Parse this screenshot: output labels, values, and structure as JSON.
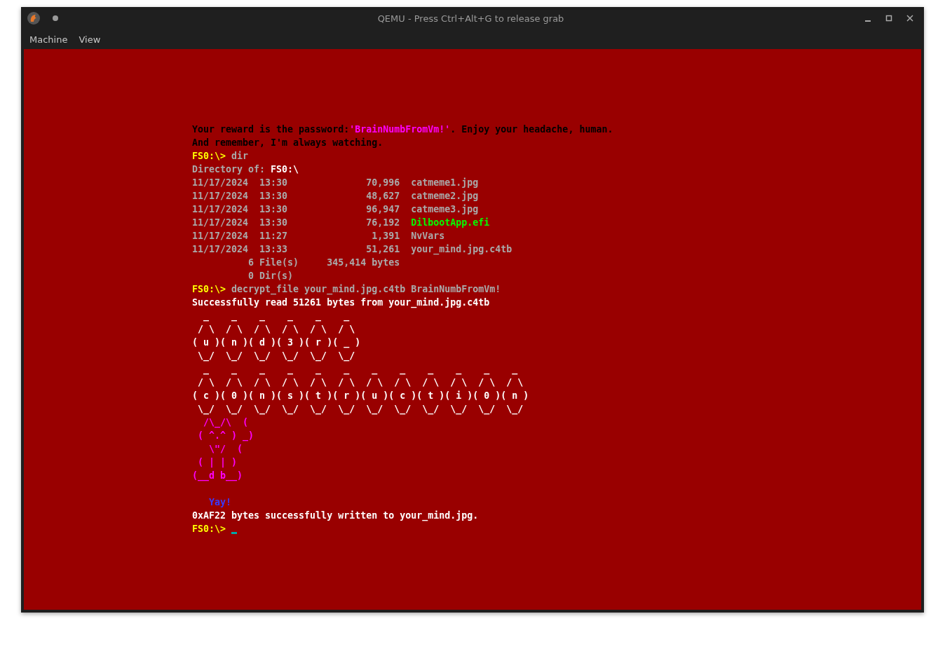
{
  "window": {
    "title": "QEMU - Press Ctrl+Alt+G to release grab"
  },
  "menu": [
    {
      "label": "Machine"
    },
    {
      "label": "View"
    }
  ],
  "screen": {
    "lines": [
      {
        "kind": "text",
        "segments": [
          {
            "text": "Your reward is the password:",
            "color": "#000000"
          },
          {
            "text": "'BrainNumbFromVm!'",
            "color": "#ff00ff"
          },
          {
            "text": ". Enjoy your headache, human.",
            "color": "#000000"
          }
        ]
      },
      {
        "kind": "text",
        "segments": [
          {
            "text": "And remember, I'm always watching.",
            "color": "#000000"
          }
        ]
      },
      {
        "kind": "text",
        "segments": [
          {
            "text": "FS0:\\>",
            "color": "#ffff00"
          },
          {
            "text": " dir",
            "color": "#aaaaaa"
          }
        ]
      },
      {
        "kind": "text",
        "segments": [
          {
            "text": "Directory of: ",
            "color": "#aaaaaa"
          },
          {
            "text": "FS0:\\",
            "color": "#ffffff"
          }
        ]
      },
      {
        "kind": "text",
        "segments": [
          {
            "text": "11/17/2024  13:30              70,996  catmeme1.jpg",
            "color": "#aaaaaa"
          }
        ]
      },
      {
        "kind": "text",
        "segments": [
          {
            "text": "11/17/2024  13:30              48,627  catmeme2.jpg",
            "color": "#aaaaaa"
          }
        ]
      },
      {
        "kind": "text",
        "segments": [
          {
            "text": "11/17/2024  13:30              96,947  catmeme3.jpg",
            "color": "#aaaaaa"
          }
        ]
      },
      {
        "kind": "text",
        "segments": [
          {
            "text": "11/17/2024  13:30              76,192  ",
            "color": "#aaaaaa"
          },
          {
            "text": "DilbootApp.efi",
            "color": "#00ff00"
          }
        ]
      },
      {
        "kind": "text",
        "segments": [
          {
            "text": "11/17/2024  11:27               1,391  NvVars",
            "color": "#aaaaaa"
          }
        ]
      },
      {
        "kind": "text",
        "segments": [
          {
            "text": "11/17/2024  13:33              51,261  your_mind.jpg.c4tb",
            "color": "#aaaaaa"
          }
        ]
      },
      {
        "kind": "text",
        "segments": [
          {
            "text": "          6 File(s)     345,414 bytes",
            "color": "#aaaaaa"
          }
        ]
      },
      {
        "kind": "text",
        "segments": [
          {
            "text": "          0 Dir(s)",
            "color": "#aaaaaa"
          }
        ]
      },
      {
        "kind": "text",
        "segments": [
          {
            "text": "FS0:\\>",
            "color": "#ffff00"
          },
          {
            "text": " decrypt_file your_mind.jpg.c4tb BrainNumbFromVm!",
            "color": "#aaaaaa"
          }
        ]
      },
      {
        "kind": "text",
        "segments": [
          {
            "text": "Successfully read 51261 bytes from your_mind.jpg.c4tb",
            "color": "#ffffff"
          }
        ]
      },
      {
        "kind": "text",
        "segments": [
          {
            "text": "  _    _    _    _    _    _",
            "color": "#ffffff"
          }
        ]
      },
      {
        "kind": "text",
        "segments": [
          {
            "text": " / \\  / \\  / \\  / \\  / \\  / \\",
            "color": "#ffffff"
          }
        ]
      },
      {
        "kind": "text",
        "segments": [
          {
            "text": "( u )( n )( d )( 3 )( r )( _ )",
            "color": "#ffffff"
          }
        ]
      },
      {
        "kind": "text",
        "segments": [
          {
            "text": " \\_/  \\_/  \\_/  \\_/  \\_/  \\_/",
            "color": "#ffffff"
          }
        ]
      },
      {
        "kind": "text",
        "segments": [
          {
            "text": "  _    _    _    _    _    _    _    _    _    _    _    _",
            "color": "#ffffff"
          }
        ]
      },
      {
        "kind": "text",
        "segments": [
          {
            "text": " / \\  / \\  / \\  / \\  / \\  / \\  / \\  / \\  / \\  / \\  / \\  / \\",
            "color": "#ffffff"
          }
        ]
      },
      {
        "kind": "text",
        "segments": [
          {
            "text": "( c )( 0 )( n )( s )( t )( r )( u )( c )( t )( i )( 0 )( n )",
            "color": "#ffffff"
          }
        ]
      },
      {
        "kind": "text",
        "segments": [
          {
            "text": " \\_/  \\_/  \\_/  \\_/  \\_/  \\_/  \\_/  \\_/  \\_/  \\_/  \\_/  \\_/",
            "color": "#ffffff"
          }
        ]
      },
      {
        "kind": "text",
        "segments": [
          {
            "text": "  /\\_/\\  (",
            "color": "#ff00ff"
          }
        ]
      },
      {
        "kind": "text",
        "segments": [
          {
            "text": " ( ^.^ ) _)",
            "color": "#ff00ff"
          }
        ]
      },
      {
        "kind": "text",
        "segments": [
          {
            "text": "   \\\"/  (",
            "color": "#ff00ff"
          }
        ]
      },
      {
        "kind": "text",
        "segments": [
          {
            "text": " ( | | )",
            "color": "#ff00ff"
          }
        ]
      },
      {
        "kind": "text",
        "segments": [
          {
            "text": "(__d b__)",
            "color": "#ff00ff"
          }
        ]
      },
      {
        "kind": "blank"
      },
      {
        "kind": "text",
        "segments": [
          {
            "text": "   Yay!",
            "color": "#3a3aff"
          }
        ]
      },
      {
        "kind": "text",
        "segments": [
          {
            "text": "0xAF22 bytes successfully written to your_mind.jpg.",
            "color": "#ffffff"
          }
        ]
      },
      {
        "kind": "prompt",
        "cursor": true,
        "segments": [
          {
            "text": "FS0:\\>",
            "color": "#ffff00"
          }
        ]
      }
    ]
  }
}
